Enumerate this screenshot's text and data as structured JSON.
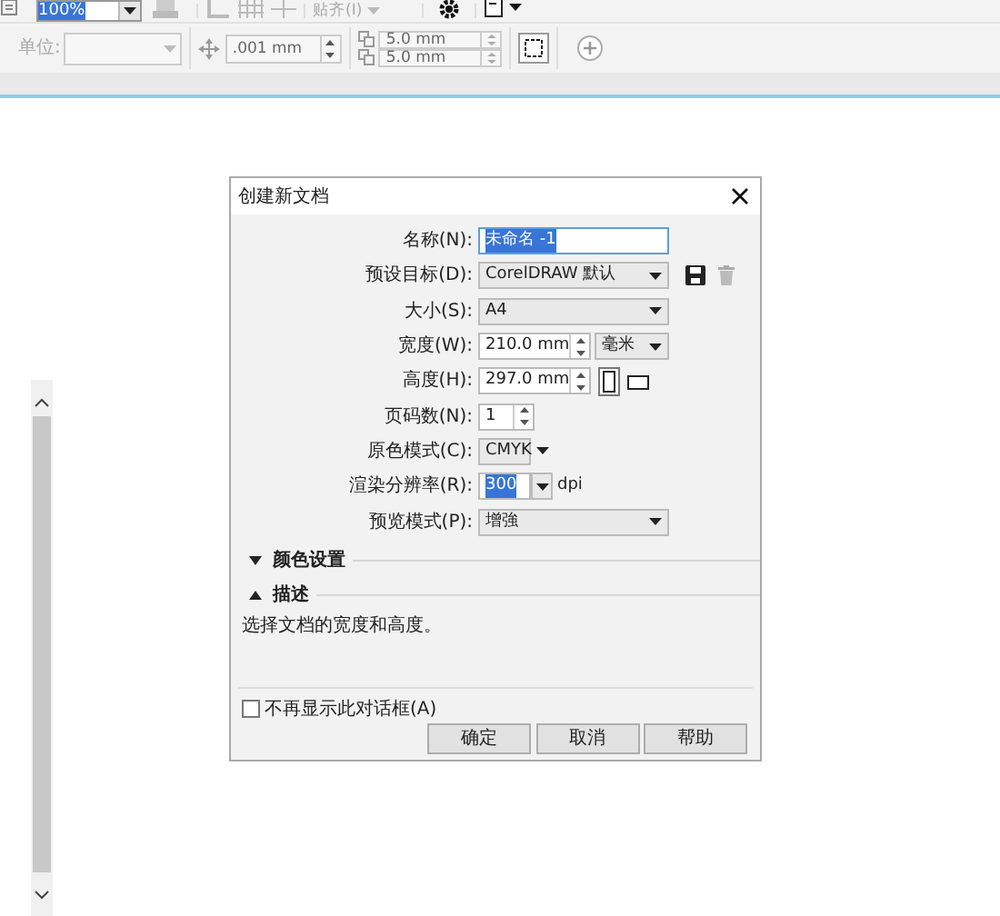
{
  "toolbar": {
    "zoom": {
      "value": "100%",
      "selected": true
    },
    "snap": {
      "label": "贴齐(I)",
      "disabled": true
    },
    "units": {
      "label": "单位:",
      "disabled": true
    },
    "nudge": {
      "value": ".001 mm"
    },
    "duplicate": [
      {
        "value": "5.0 mm"
      },
      {
        "value": "5.0 mm"
      }
    ]
  },
  "dialog": {
    "title": "创建新文档",
    "fields": [
      {
        "label": "名称(N):",
        "kind": "text",
        "value": "未命名 -1",
        "selected": true
      },
      {
        "label": "预设目标(D):",
        "kind": "select-actions",
        "value": "CorelDRAW 默认"
      },
      {
        "label": "大小(S):",
        "kind": "select",
        "value": "A4"
      },
      {
        "label": "宽度(W):",
        "kind": "spinner-unit",
        "value": "210.0 mm",
        "unit": "毫米"
      },
      {
        "label": "高度(H):",
        "kind": "spinner-orientation",
        "value": "297.0 mm",
        "orientations": [
          {
            "selected": true
          },
          {
            "selected": false
          }
        ]
      },
      {
        "label": "页码数(N):",
        "kind": "spinner",
        "value": "1"
      },
      {
        "label": "原色模式(C):",
        "kind": "select-short",
        "value": "CMYK"
      },
      {
        "label": "渲染分辨率(R):",
        "kind": "combo",
        "value": "300",
        "selected": true,
        "suffix": "dpi"
      },
      {
        "label": "预览模式(P):",
        "kind": "select",
        "value": "增強"
      }
    ],
    "sections": [
      {
        "label": "颜色设置",
        "expanded": false
      },
      {
        "label": "描述",
        "expanded": true
      }
    ],
    "description": "选择文档的宽度和高度。",
    "dont_show": {
      "label": "不再显示此对话框(A)",
      "checked": false
    },
    "buttons": [
      "确定",
      "取消",
      "帮助"
    ]
  }
}
